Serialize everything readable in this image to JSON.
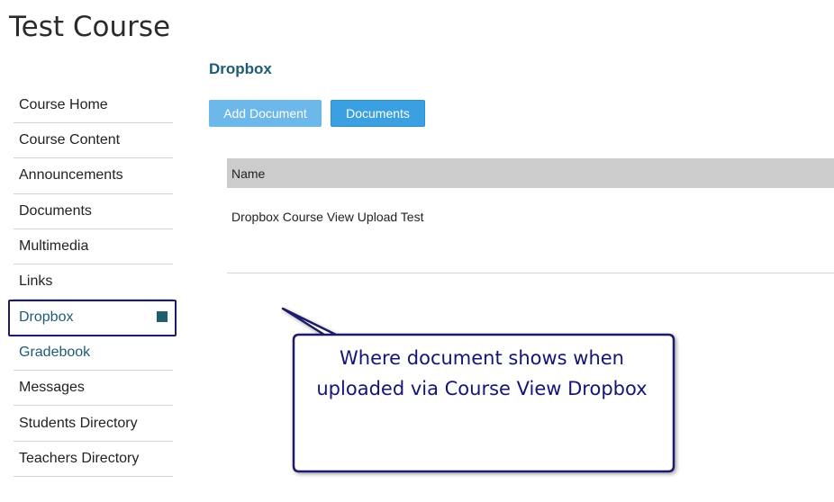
{
  "course": {
    "title": "Test Course"
  },
  "sidebar": {
    "items": [
      {
        "label": "Course Home"
      },
      {
        "label": "Course Content"
      },
      {
        "label": "Announcements"
      },
      {
        "label": "Documents"
      },
      {
        "label": "Multimedia"
      },
      {
        "label": "Links"
      },
      {
        "label": "Dropbox",
        "active": true
      },
      {
        "label": "Gradebook"
      },
      {
        "label": "Messages"
      },
      {
        "label": "Students Directory"
      },
      {
        "label": "Teachers Directory"
      }
    ]
  },
  "main": {
    "title": "Dropbox",
    "buttons": {
      "add_document": "Add Document",
      "documents": "Documents"
    },
    "table": {
      "header": "Name",
      "rows": [
        {
          "name": "Dropbox Course View Upload Test"
        }
      ]
    }
  },
  "callout": {
    "line1": "Where document shows when",
    "line2": "uploaded via Course View Dropbox"
  },
  "colors": {
    "accent": "#1f5c74",
    "button_light": "#6cb8ea",
    "button": "#3aa0e2",
    "callout_border": "#1c1c6b",
    "callout_text": "#14147a",
    "table_header": "#cccccc"
  }
}
